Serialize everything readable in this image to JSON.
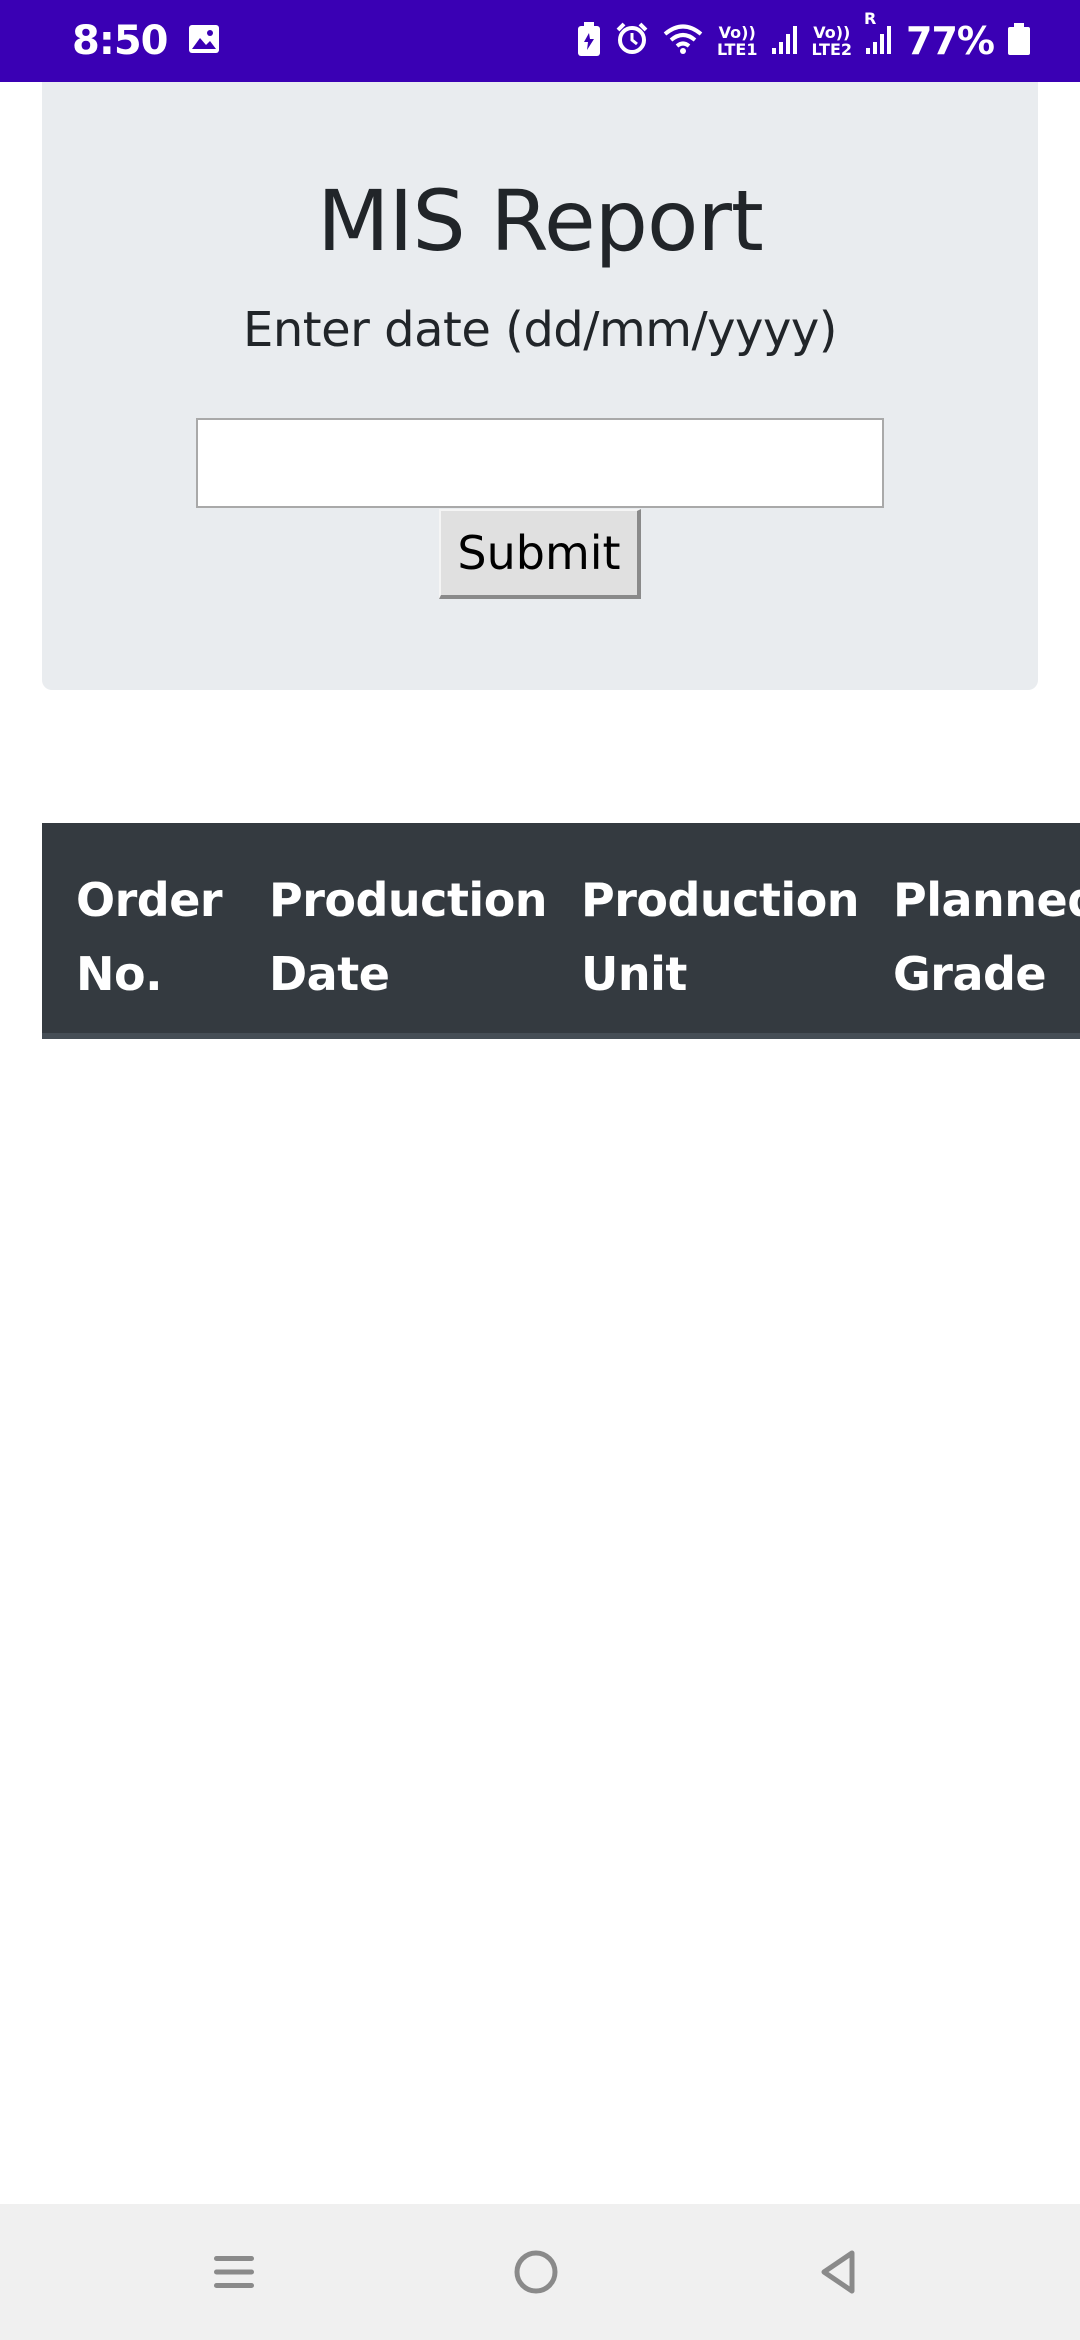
{
  "status_bar": {
    "time": "8:50",
    "sim1_label_top": "Vo))",
    "sim1_label_bottom": "LTE1",
    "sim2_label_top": "Vo))",
    "sim2_label_bottom": "LTE2",
    "roaming": "R",
    "battery": "77%"
  },
  "report": {
    "title": "MIS Report",
    "date_label": "Enter date (dd/mm/yyyy)",
    "date_input_value": "",
    "submit_label": "Submit"
  },
  "table": {
    "columns": [
      {
        "line1": "Order",
        "line2": "No."
      },
      {
        "line1": "Production",
        "line2": "Date"
      },
      {
        "line1": "Production",
        "line2": "Unit"
      },
      {
        "line1": "Planned",
        "line2": "Grade"
      }
    ],
    "rows": []
  },
  "nav_bar": {
    "icons": [
      "recent-apps-icon",
      "home-icon",
      "back-icon"
    ]
  },
  "colors": {
    "status_bar": "#3a00b4",
    "card_bg": "#e9ecef",
    "table_header_bg": "#343a40"
  }
}
